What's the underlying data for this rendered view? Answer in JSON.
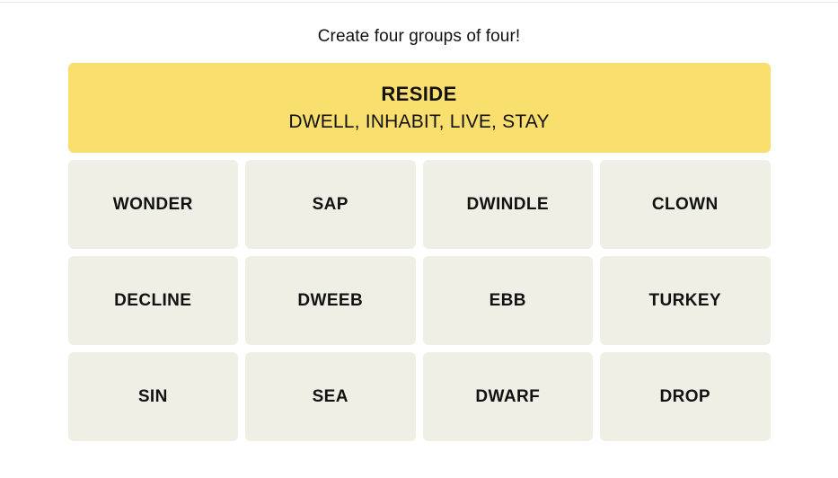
{
  "game": {
    "instructions": "Create four groups of four!",
    "colors": {
      "page_background": "#FFFFFF",
      "tile_background": "#EFEFE6",
      "text": "#121212",
      "solved_yellow": "#F9DF6D",
      "top_rule": "#E6E6E6"
    },
    "solved_groups": [
      {
        "category": "RESIDE",
        "members_text": "DWELL, INHABIT, LIVE, STAY",
        "members": [
          "DWELL",
          "INHABIT",
          "LIVE",
          "STAY"
        ],
        "color": "#F9DF6D",
        "difficulty": "yellow"
      }
    ],
    "grid": {
      "rows": [
        {
          "tiles": [
            {
              "word": "WONDER"
            },
            {
              "word": "SAP"
            },
            {
              "word": "DWINDLE"
            },
            {
              "word": "CLOWN"
            }
          ]
        },
        {
          "tiles": [
            {
              "word": "DECLINE"
            },
            {
              "word": "DWEEB"
            },
            {
              "word": "EBB"
            },
            {
              "word": "TURKEY"
            }
          ]
        },
        {
          "tiles": [
            {
              "word": "SIN"
            },
            {
              "word": "SEA"
            },
            {
              "word": "DWARF"
            },
            {
              "word": "DROP"
            }
          ]
        }
      ]
    }
  }
}
